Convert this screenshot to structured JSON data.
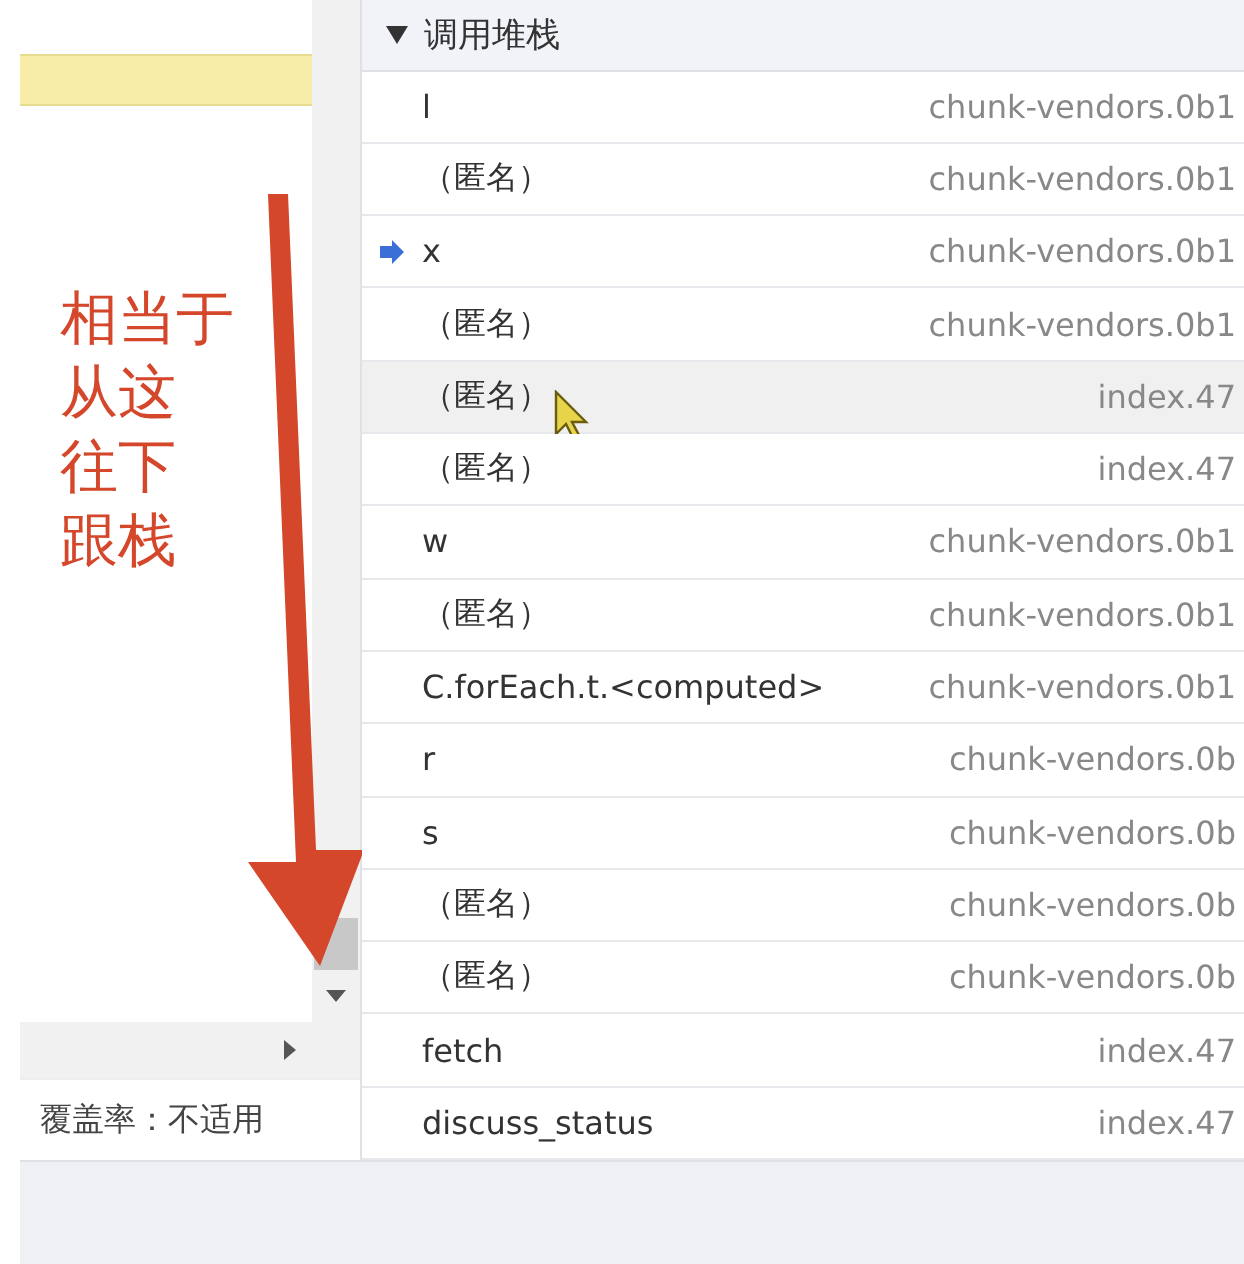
{
  "left_panel": {
    "annotation": [
      "相当于",
      "从这",
      "往下",
      "跟栈"
    ],
    "coverage": "覆盖率：不适用"
  },
  "call_stack": {
    "title": "调用堆栈",
    "expanded": true,
    "frames": [
      {
        "name": "l",
        "location": "chunk-vendors.0b1",
        "current": false,
        "selected": false
      },
      {
        "name": "（匿名）",
        "location": "chunk-vendors.0b1",
        "current": false,
        "selected": false
      },
      {
        "name": "x",
        "location": "chunk-vendors.0b1",
        "current": true,
        "selected": false
      },
      {
        "name": "（匿名）",
        "location": "chunk-vendors.0b1",
        "current": false,
        "selected": false
      },
      {
        "name": "（匿名）",
        "location": "index.47",
        "current": false,
        "selected": true
      },
      {
        "name": "（匿名）",
        "location": "index.47",
        "current": false,
        "selected": false
      },
      {
        "name": "w",
        "location": "chunk-vendors.0b1",
        "current": false,
        "selected": false
      },
      {
        "name": "（匿名）",
        "location": "chunk-vendors.0b1",
        "current": false,
        "selected": false
      },
      {
        "name": "C.forEach.t.<computed>",
        "location": "chunk-vendors.0b1",
        "current": false,
        "selected": false
      },
      {
        "name": "r",
        "location": "chunk-vendors.0b",
        "current": false,
        "selected": false
      },
      {
        "name": "s",
        "location": "chunk-vendors.0b",
        "current": false,
        "selected": false
      },
      {
        "name": "（匿名）",
        "location": "chunk-vendors.0b",
        "current": false,
        "selected": false
      },
      {
        "name": "（匿名）",
        "location": "chunk-vendors.0b",
        "current": false,
        "selected": false
      },
      {
        "name": "fetch",
        "location": "index.47",
        "current": false,
        "selected": false
      },
      {
        "name": "discuss_status",
        "location": "index.47",
        "current": false,
        "selected": false
      }
    ]
  }
}
